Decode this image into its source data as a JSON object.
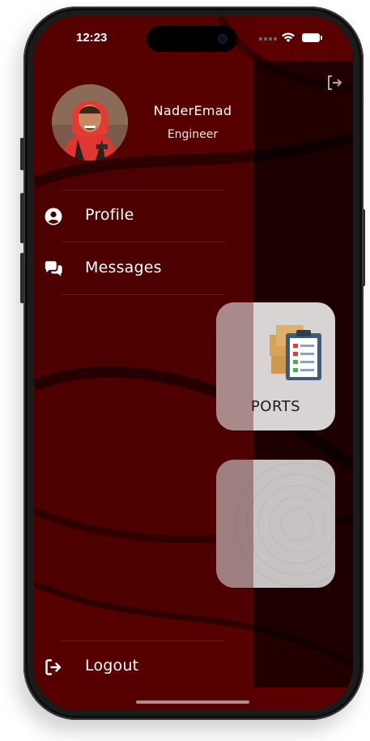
{
  "status_bar": {
    "time": "12:23"
  },
  "user": {
    "name": "NaderEmad",
    "role": "Engineer"
  },
  "menu": {
    "items": [
      {
        "label": "Profile",
        "icon": "user-circle-icon"
      },
      {
        "label": "Messages",
        "icon": "chat-bubbles-icon"
      }
    ],
    "logout": {
      "label": "Logout",
      "icon": "logout-icon"
    }
  },
  "dashboard": {
    "cards": [
      {
        "label": "PORTS",
        "icon": "reports-clipboard-icon"
      },
      {
        "label": "",
        "icon": ""
      }
    ]
  },
  "colors": {
    "background": "#3a0000",
    "drawer": "#5a0000",
    "text": "#ffffff"
  }
}
